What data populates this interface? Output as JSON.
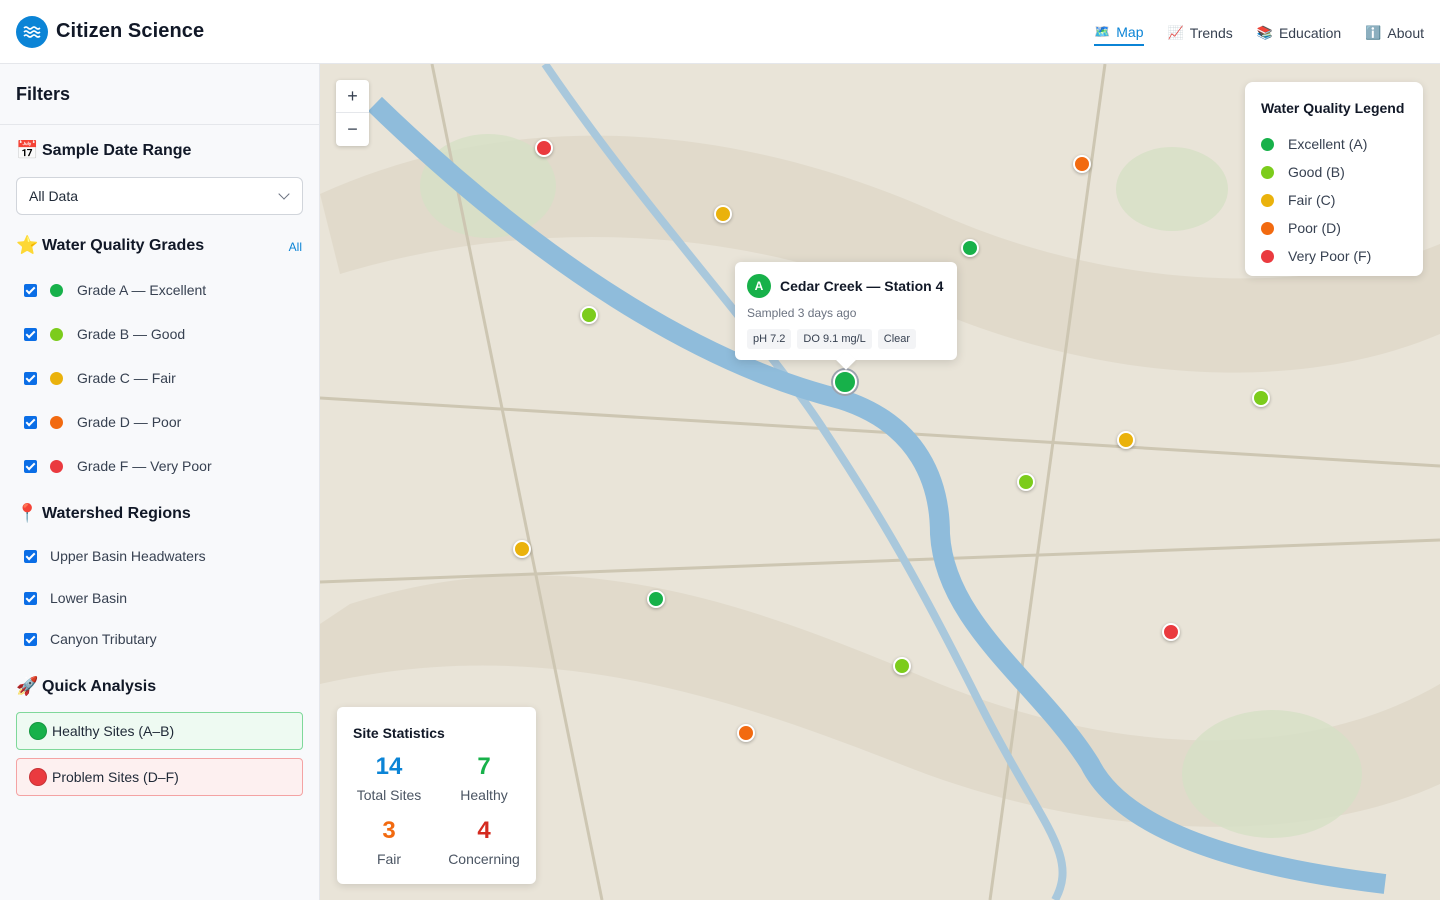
{
  "header": {
    "app_title": "Citizen Science",
    "logo_icon": "water-waves-icon",
    "nav": [
      {
        "icon": "🗺️",
        "label": "Map",
        "active": true
      },
      {
        "icon": "📈",
        "label": "Trends",
        "active": false
      },
      {
        "icon": "📚",
        "label": "Education",
        "active": false
      },
      {
        "icon": "ℹ️",
        "label": "About",
        "active": false
      }
    ]
  },
  "sidebar": {
    "title": "Filters",
    "date_range": {
      "icon": "📅",
      "heading": "Sample Date Range",
      "selected": "All Data"
    },
    "grades": {
      "icon": "⭐",
      "heading": "Water Quality Grades",
      "all_link": "All",
      "items": [
        {
          "label": "Grade A — Excellent",
          "color": "#17b14a",
          "checked": true
        },
        {
          "label": "Grade B — Good",
          "color": "#7ccc1c",
          "checked": true
        },
        {
          "label": "Grade C — Fair",
          "color": "#eab20c",
          "checked": true
        },
        {
          "label": "Grade D — Poor",
          "color": "#f26a10",
          "checked": true
        },
        {
          "label": "Grade F — Very Poor",
          "color": "#ea3a3f",
          "checked": true
        }
      ]
    },
    "regions": {
      "icon": "📍",
      "heading": "Watershed Regions",
      "items": [
        {
          "label": "Upper Basin Headwaters",
          "checked": true
        },
        {
          "label": "Lower Basin",
          "checked": true
        },
        {
          "label": "Canyon Tributary",
          "checked": true
        }
      ]
    },
    "quick_analysis": {
      "icon": "🚀",
      "heading": "Quick Analysis",
      "healthy_label": "Healthy Sites (A–B)",
      "problem_label": "Problem Sites (D–F)"
    }
  },
  "map": {
    "zoom_in": "+",
    "zoom_out": "−",
    "legend": {
      "title": "Water Quality Legend",
      "items": [
        {
          "label": "Excellent (A)",
          "color": "#17b14a"
        },
        {
          "label": "Good (B)",
          "color": "#7ccc1c"
        },
        {
          "label": "Fair (C)",
          "color": "#eab20c"
        },
        {
          "label": "Poor (D)",
          "color": "#f26a10"
        },
        {
          "label": "Very Poor (F)",
          "color": "#ea3a3f"
        }
      ]
    },
    "popup": {
      "grade": "A",
      "title": "Cedar Creek — Station 4",
      "subtitle": "Sampled 3 days ago",
      "chips": [
        "pH 7.2",
        "DO 9.1 mg/L",
        "Clear"
      ]
    },
    "stats": {
      "title": "Site Statistics",
      "total": {
        "value": "14",
        "label": "Total Sites",
        "color": "#0b84d6"
      },
      "healthy": {
        "value": "7",
        "label": "Healthy",
        "color": "#17b14a"
      },
      "fair": {
        "value": "3",
        "label": "Fair",
        "color": "#f26a10"
      },
      "concerning": {
        "value": "4",
        "label": "Concerning",
        "color": "#d42a1f"
      }
    },
    "site_grades": [
      "F",
      "C",
      "B",
      "A",
      "D",
      "A",
      "B",
      "C",
      "B",
      "C",
      "A",
      "B",
      "D",
      "F"
    ]
  }
}
